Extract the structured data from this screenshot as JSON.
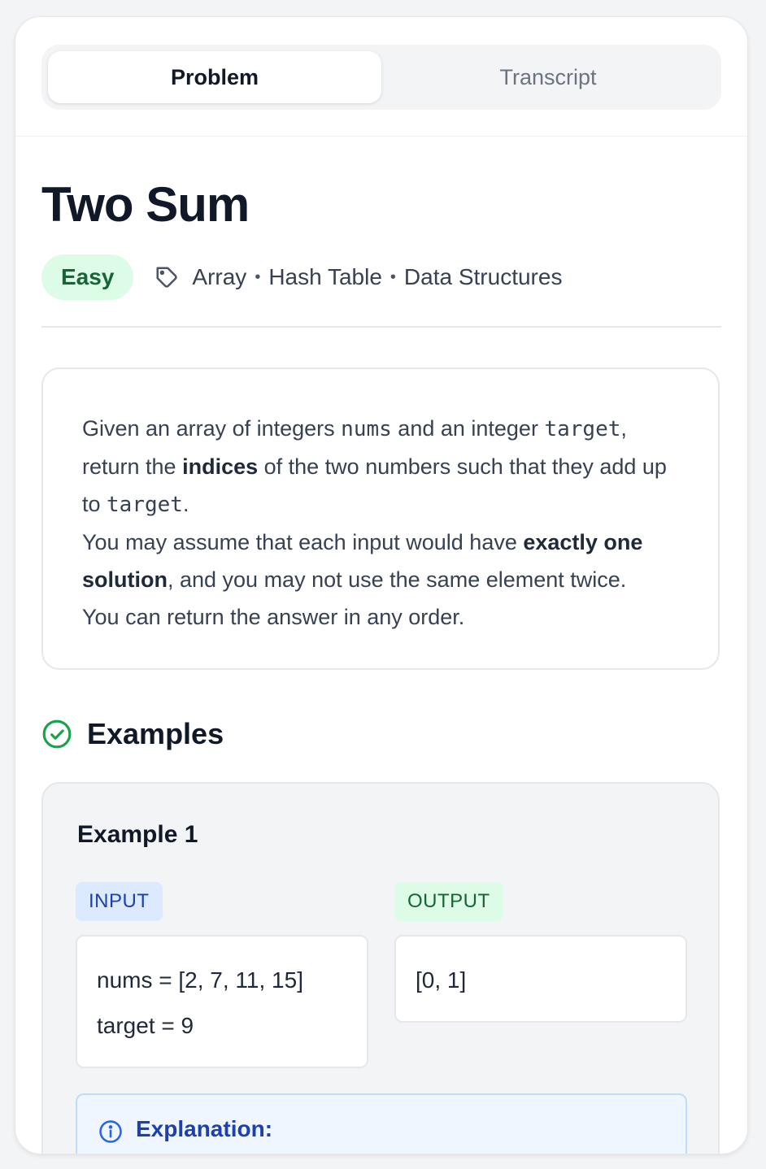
{
  "tabs": {
    "problem": "Problem",
    "transcript": "Transcript",
    "active": "Problem"
  },
  "problem": {
    "title": "Two Sum",
    "difficulty": "Easy",
    "tags": [
      "Array",
      "Hash Table",
      "Data Structures"
    ],
    "tag_separator": "•",
    "description": {
      "p1_a": "Given an array of integers ",
      "p1_code1": "nums",
      "p1_b": " and an integer ",
      "p1_code2": "target",
      "p1_c": ", return the ",
      "p1_bold": "indices",
      "p1_d": " of the two numbers such that they add up to ",
      "p1_code3": "target",
      "p1_e": ".",
      "p2_a": "You may assume that each input would have ",
      "p2_bold": "exactly one solution",
      "p2_b": ", and you may not use the same element twice.",
      "p3": "You can return the answer in any order."
    }
  },
  "examples": {
    "heading": "Examples",
    "items": [
      {
        "title": "Example 1",
        "input_label": "INPUT",
        "output_label": "OUTPUT",
        "input_lines": [
          "nums = [2, 7, 11, 15]",
          "target = 9"
        ],
        "output": "[0, 1]",
        "explanation_label": "Explanation:"
      }
    ]
  },
  "colors": {
    "difficulty_bg": "#dcfce7",
    "difficulty_text": "#166534",
    "input_pill_bg": "#dbeafe",
    "output_pill_bg": "#dcfce7",
    "success_icon": "#16a34a",
    "info_icon": "#2563eb"
  },
  "icons": {
    "tag": "tag-icon",
    "examples": "check-circle-icon",
    "explanation": "info-icon"
  }
}
